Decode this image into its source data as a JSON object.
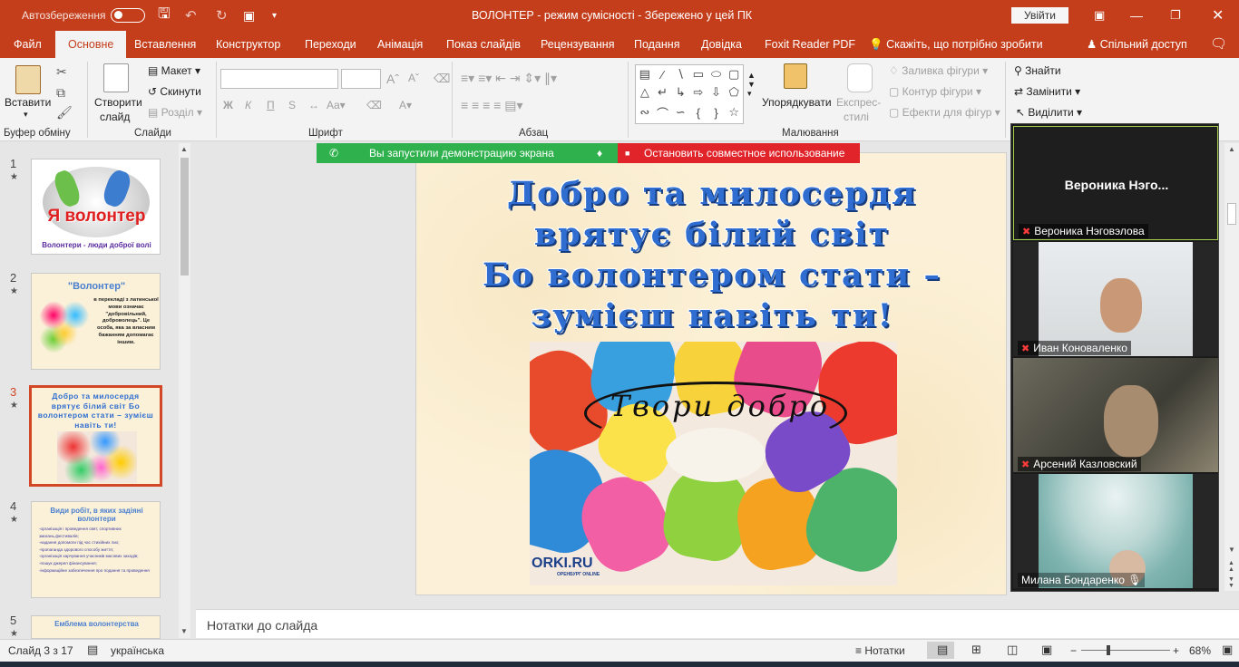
{
  "titlebar": {
    "autosave": "Автозбереження",
    "title": "ВОЛОНТЕР  -  режим сумісності  -  Збережено у цей ПК",
    "signin": "Увійти"
  },
  "menu": [
    "Файл",
    "Основне",
    "Вставлення",
    "Конструктор",
    "Переходи",
    "Анімація",
    "Показ слайдів",
    "Рецензування",
    "Подання",
    "Довідка",
    "Foxit Reader PDF"
  ],
  "tellme": "Скажіть, що потрібно зробити",
  "share": "Спільний доступ",
  "ribbon": {
    "paste": "Вставити",
    "clipboard": "Буфер обміну",
    "new_slide_1": "Створити",
    "new_slide_2": "слайд",
    "layout": "Макет",
    "reset": "Скинути",
    "section": "Розділ",
    "slides": "Слайди",
    "font": "Шрифт",
    "bold": "Ж",
    "italic": "К",
    "underline": "П",
    "strike": "S",
    "paragraph": "Абзац",
    "arrange": "Упорядкувати",
    "quick_styles_1": "Експрес-",
    "quick_styles_2": "стилі",
    "shape_fill": "Заливка фігури",
    "shape_outline": "Контур фігури",
    "shape_effects": "Ефекти для фігур",
    "drawing": "Малювання",
    "find": "Знайти",
    "replace": "Замінити",
    "select": "Виділити"
  },
  "share_bar": {
    "green": "Вы запустили демонстрацию экрана",
    "red": "Остановить совместное использование"
  },
  "slides": [
    {
      "num": "1",
      "title": "Я волонтер",
      "caption": "Волонтери - люди доброї волі"
    },
    {
      "num": "2",
      "title": "\"Волонтер\"",
      "text": "в перекладі з латинської мови означає \"добровільний, доброволець\". Це особа, яка за власним бажанням допомагає іншим."
    },
    {
      "num": "3",
      "title": "Добро та милосердя врятує білий світ Бо волонтером стати – зумієш навіть ти!"
    },
    {
      "num": "4",
      "title": "Види робіт, в яких задіяні волонтери",
      "items": [
        "-організація і проведення свят, спортивних змагань,фестивалів;",
        "-надання допомоги під час стихійних лих;",
        "-пропаганда здорового способу життя;",
        "-організація харчування учасників масових заходів;",
        "-пошук джерел фінансування;",
        "-інформаційне забезпечення про подання та проведення"
      ]
    },
    {
      "num": "5",
      "title": "Емблема волонтерства"
    }
  ],
  "main_slide": {
    "title": [
      "Добро та милосердя",
      "врятує білий світ",
      "Бо волонтером стати –",
      "зумієш навіть ти!"
    ],
    "image_caption": "Твори добро",
    "brand": "ORKI.RU",
    "brand_sub": "ОРЕНБУРГ ONLINE"
  },
  "zoom": {
    "p1_big": "Вероника  Нэго...",
    "p1": "Вероника Нэговэлова",
    "p2": "Иван Коноваленко",
    "p3": "Арсений Казловский",
    "p4": "Милана Бондаренко"
  },
  "notes": "Нотатки до слайда",
  "status": {
    "slide": "Слайд 3 з 17",
    "lang": "українська",
    "notes": "Нотатки",
    "zoom": "68%"
  },
  "colors": {
    "accent": "#c43e1c",
    "slide_title": "#2f6ed0",
    "share_green": "#2fb24d",
    "share_red": "#e0242a",
    "selected_thumb": "#d24726"
  }
}
